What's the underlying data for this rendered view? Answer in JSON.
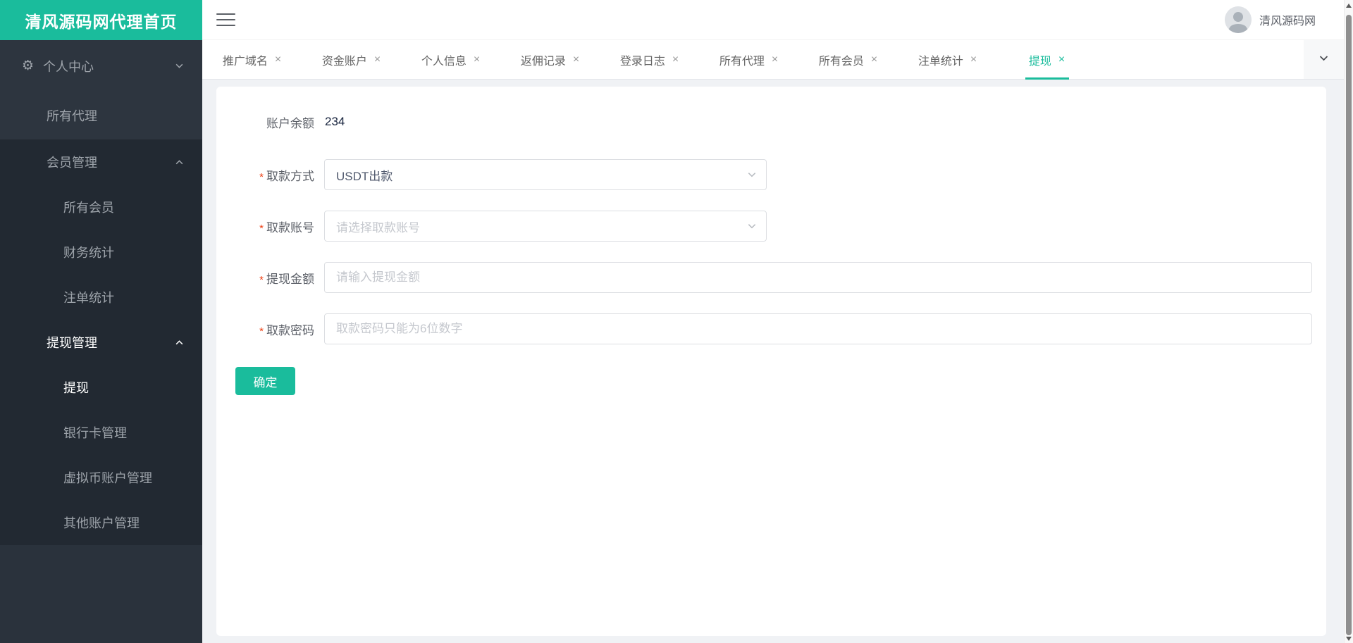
{
  "colors": {
    "accent": "#1abc9c",
    "sidebar_bg": "#2a323c",
    "sidebar_submenu_bg": "#222932",
    "required_red": "#ed4014",
    "content_bg": "#f0f2f5"
  },
  "logo": {
    "title": "清风源码网代理首页"
  },
  "topbar": {
    "username": "清风源码网"
  },
  "sidebar": {
    "items": [
      {
        "label": "个人中心"
      },
      {
        "label": "所有代理"
      },
      {
        "label": "会员管理"
      },
      {
        "label": "所有会员"
      },
      {
        "label": "财务统计"
      },
      {
        "label": "注单统计"
      },
      {
        "label": "提现管理"
      },
      {
        "label": "提现"
      },
      {
        "label": "银行卡管理"
      },
      {
        "label": "虚拟币账户管理"
      },
      {
        "label": "其他账户管理"
      }
    ]
  },
  "tabs": {
    "close_mark": "×",
    "items": [
      {
        "label": "推广域名"
      },
      {
        "label": "资金账户"
      },
      {
        "label": "个人信息"
      },
      {
        "label": "返佣记录"
      },
      {
        "label": "登录日志"
      },
      {
        "label": "所有代理"
      },
      {
        "label": "所有会员"
      },
      {
        "label": "注单统计"
      },
      {
        "label": "提现",
        "active": true
      }
    ]
  },
  "form": {
    "required_mark": "*",
    "balance_label": "账户余额",
    "balance_value": "234",
    "fields": [
      {
        "label": "取款方式",
        "value": "USDT出款"
      },
      {
        "label": "取款账号",
        "placeholder": "请选择取款账号"
      },
      {
        "label": "提现金额",
        "placeholder": "请输入提现金额"
      },
      {
        "label": "取款密码",
        "placeholder": "取款密码只能为6位数字"
      }
    ],
    "submit_label": "确定"
  }
}
